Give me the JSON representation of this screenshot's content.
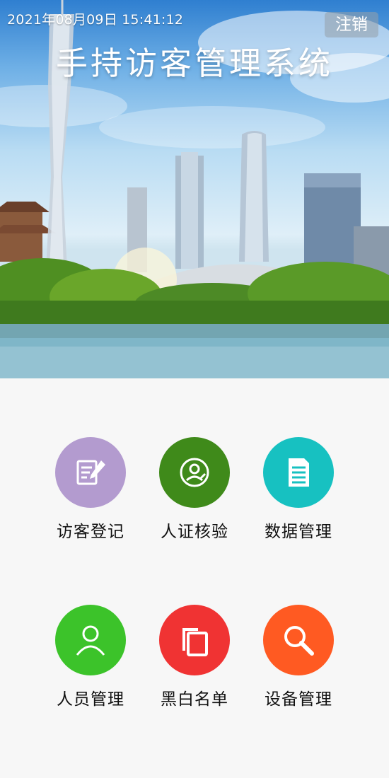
{
  "header": {
    "datetime": "2021年08月09日 15:41:12",
    "logout_label": "注销",
    "title": "手持访客管理系统"
  },
  "menu": [
    {
      "label": "访客登记",
      "icon": "register-form-icon",
      "color": "#b39bcf"
    },
    {
      "label": "人证核验",
      "icon": "id-verify-icon",
      "color": "#3f8a1a"
    },
    {
      "label": "数据管理",
      "icon": "document-icon",
      "color": "#17c1c1"
    },
    {
      "label": "人员管理",
      "icon": "person-icon",
      "color": "#3cc32a"
    },
    {
      "label": "黑白名单",
      "icon": "copy-list-icon",
      "color": "#f03333"
    },
    {
      "label": "设备管理",
      "icon": "search-icon",
      "color": "#ff5a22"
    }
  ]
}
